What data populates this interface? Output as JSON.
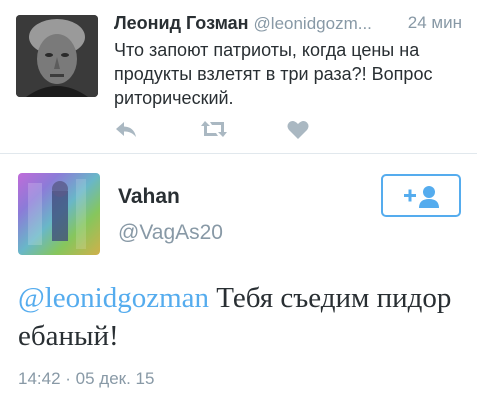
{
  "parent_tweet": {
    "author_name": "Леонид Гозман",
    "author_handle": "@leonidgozm...",
    "time": "24 мин",
    "text": "Что запоют патриоты, когда цены на продукты взлетят в три раза?! Вопрос риторический.",
    "actions": {
      "reply_icon": "reply-icon",
      "retweet_icon": "retweet-icon",
      "like_icon": "heart-icon"
    }
  },
  "main_tweet": {
    "author_name": "Vahan",
    "author_handle": "@VagAs20",
    "follow_icon": "add-user-icon",
    "mention": "@leonidgozman",
    "text_rest": " Тебя съедим пидор ебаный!",
    "timestamp": "14:42 · 05 дек. 15"
  },
  "colors": {
    "accent": "#55acee",
    "muted": "#8899a6",
    "text": "#292f33",
    "divider": "#e1e8ed"
  }
}
